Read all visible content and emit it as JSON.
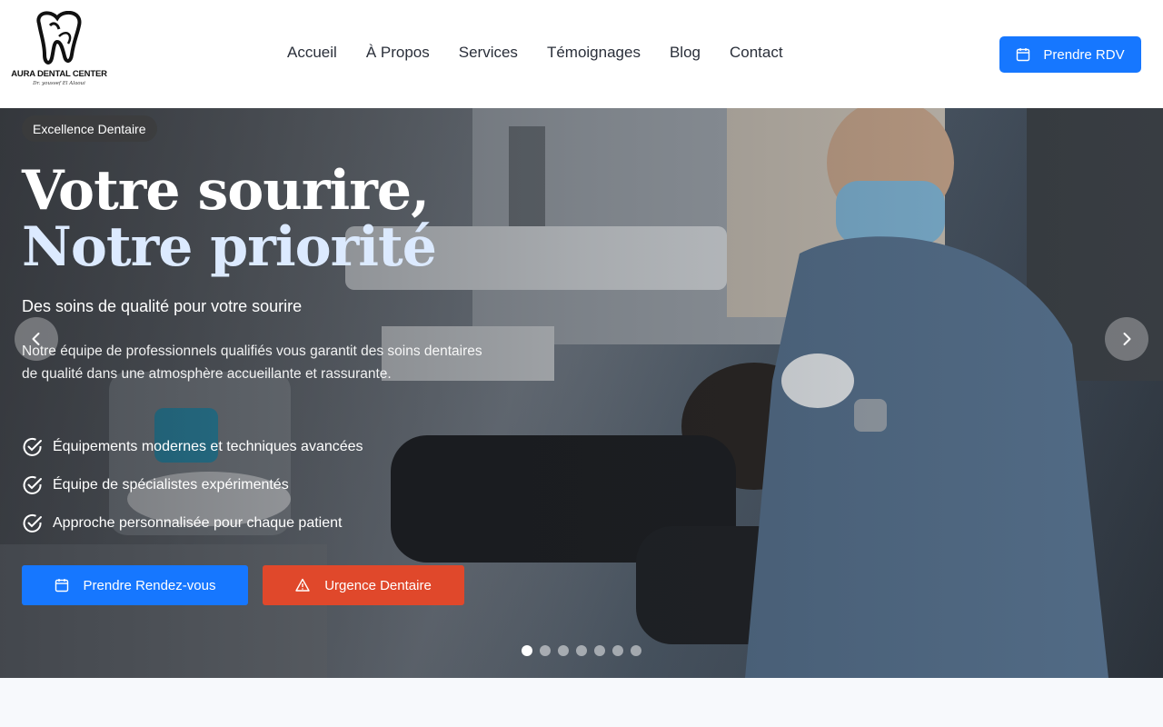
{
  "brand": {
    "name": "AURA DENTAL CENTER",
    "tagline": "Dr. youssef El Alaoui"
  },
  "nav": {
    "items": [
      {
        "label": "Accueil"
      },
      {
        "label": "À Propos"
      },
      {
        "label": "Services"
      },
      {
        "label": "Témoignages"
      },
      {
        "label": "Blog"
      },
      {
        "label": "Contact"
      }
    ]
  },
  "header": {
    "cta_label": "Prendre RDV",
    "cta_icon": "calendar-icon",
    "cta_color": "#1677ff"
  },
  "hero": {
    "badge": "Excellence Dentaire",
    "title_line1": "Votre sourire,",
    "title_line2": "Notre priorité",
    "subtitle": "Des soins de qualité pour votre sourire",
    "description": "Notre équipe de professionnels qualifiés vous garantit des soins dentaires de qualité dans une atmosphère accueillante et rassurante.",
    "features": [
      {
        "label": "Équipements modernes et techniques avancées",
        "icon": "check-circle-icon"
      },
      {
        "label": "Équipe de spécialistes expérimentés",
        "icon": "check-circle-icon"
      },
      {
        "label": "Approche personnalisée pour chaque patient",
        "icon": "check-circle-icon"
      }
    ],
    "primary_cta": {
      "label": "Prendre Rendez-vous",
      "icon": "calendar-icon",
      "color": "#1677ff"
    },
    "secondary_cta": {
      "label": "Urgence Dentaire",
      "icon": "warning-icon",
      "color": "#e0482b"
    },
    "carousel": {
      "slide_count": 7,
      "active_index": 0
    }
  }
}
